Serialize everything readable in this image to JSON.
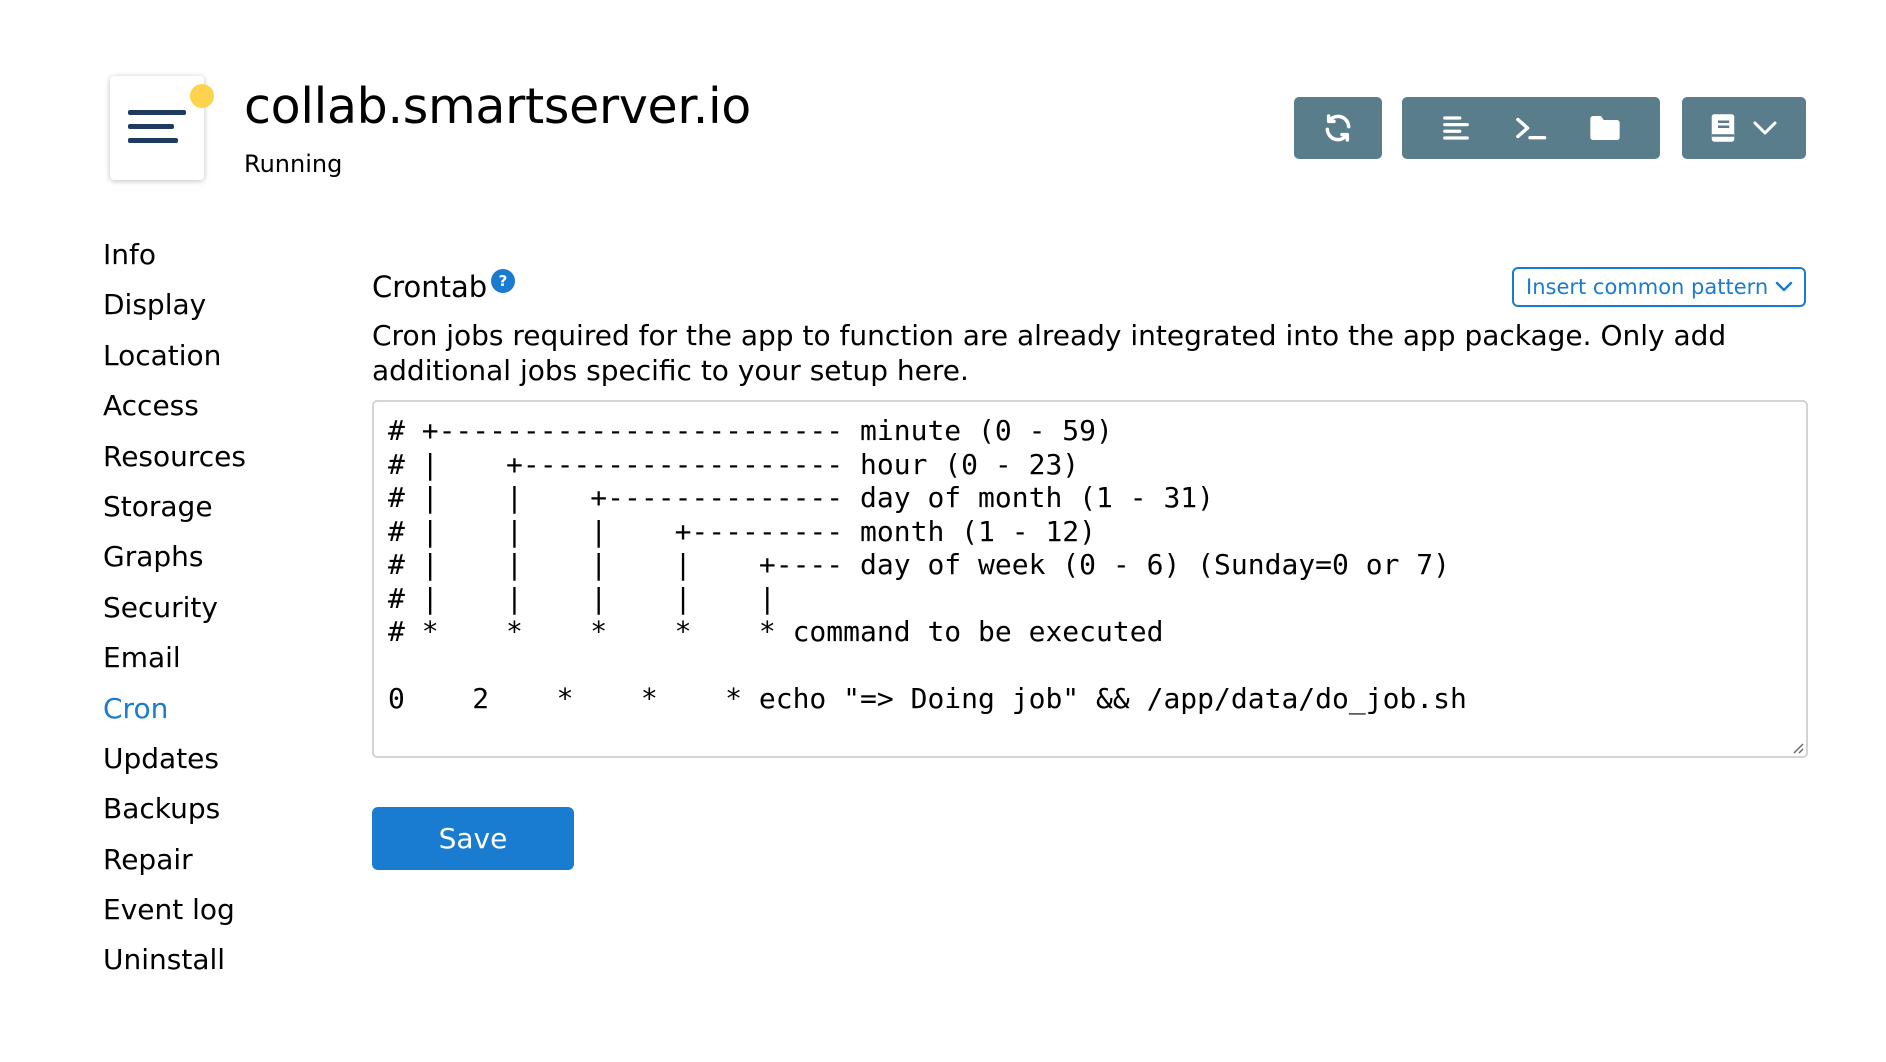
{
  "header": {
    "app_title": "collab.smartserver.io",
    "status": "Running",
    "status_color": "#fcd34d",
    "toolbar_icons": [
      "refresh-icon",
      "logs-icon",
      "terminal-icon",
      "folder-icon",
      "book-icon",
      "chevron-down-icon"
    ],
    "toolbar_color": "#5a7d8c"
  },
  "sidebar": {
    "items": [
      {
        "label": "Info"
      },
      {
        "label": "Display"
      },
      {
        "label": "Location"
      },
      {
        "label": "Access"
      },
      {
        "label": "Resources"
      },
      {
        "label": "Storage"
      },
      {
        "label": "Graphs"
      },
      {
        "label": "Security"
      },
      {
        "label": "Email"
      },
      {
        "label": "Cron"
      },
      {
        "label": "Updates"
      },
      {
        "label": "Backups"
      },
      {
        "label": "Repair"
      },
      {
        "label": "Event log"
      },
      {
        "label": "Uninstall"
      }
    ],
    "active": "Cron",
    "active_color": "#1a7cd0"
  },
  "main": {
    "title": "Crontab",
    "help_icon": "?",
    "pattern_select": "Insert common pattern",
    "description": "Cron jobs required for the app to function are already integrated into the app package. Only add additional jobs specific to your setup here.",
    "crontab": "# +------------------------ minute (0 - 59)\n# |    +------------------- hour (0 - 23)\n# |    |    +-------------- day of month (1 - 31)\n# |    |    |    +--------- month (1 - 12)\n# |    |    |    |    +---- day of week (0 - 6) (Sunday=0 or 7)\n# |    |    |    |    |\n# *    *    *    *    * command to be executed\n\n0    2    *    *    * echo \"=> Doing job\" && /app/data/do_job.sh",
    "save_label": "Save"
  }
}
